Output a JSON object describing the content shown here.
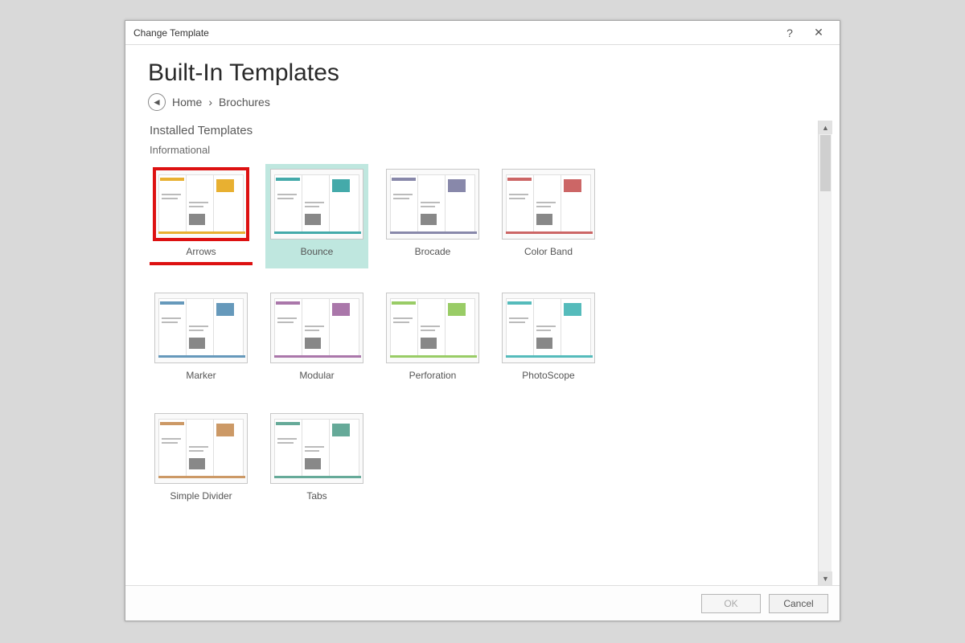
{
  "dialog": {
    "title": "Change Template",
    "heading": "Built-In Templates",
    "breadcrumb": {
      "home": "Home",
      "sep": "›",
      "current": "Brochures"
    },
    "section_title": "Installed Templates",
    "subsection_title": "Informational",
    "templates": [
      {
        "label": "Arrows",
        "highlighted": true
      },
      {
        "label": "Bounce",
        "selected": true
      },
      {
        "label": "Brocade"
      },
      {
        "label": "Color Band"
      },
      {
        "label": "Marker"
      },
      {
        "label": "Modular"
      },
      {
        "label": "Perforation"
      },
      {
        "label": "PhotoScope"
      },
      {
        "label": "Simple Divider"
      },
      {
        "label": "Tabs"
      }
    ],
    "buttons": {
      "ok": "OK",
      "cancel": "Cancel"
    }
  }
}
